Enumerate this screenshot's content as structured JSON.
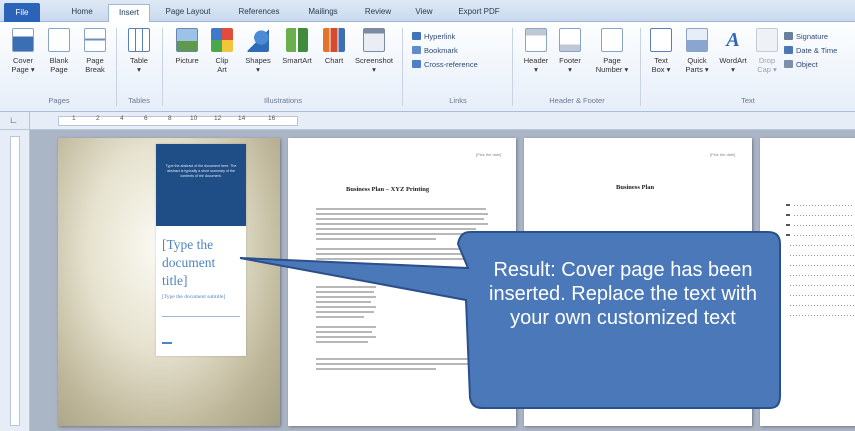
{
  "ribbon_tabs": [
    "File",
    "Home",
    "Insert",
    "Page Layout",
    "References",
    "Mailings",
    "Review",
    "View",
    "Export PDF"
  ],
  "active_tab": "Insert",
  "groups": {
    "pages": {
      "label": "Pages",
      "buttons": [
        {
          "label": "Cover\nPage ▾",
          "icon": "cover-page-icon"
        },
        {
          "label": "Blank\nPage",
          "icon": "blank-page-icon"
        },
        {
          "label": "Page\nBreak",
          "icon": "page-break-icon"
        }
      ]
    },
    "tables": {
      "label": "Tables",
      "buttons": [
        {
          "label": "Table\n▾",
          "icon": "table-icon"
        }
      ]
    },
    "illustrations": {
      "label": "Illustrations",
      "buttons": [
        {
          "label": "Picture",
          "icon": "picture-icon"
        },
        {
          "label": "Clip\nArt",
          "icon": "clip-art-icon"
        },
        {
          "label": "Shapes\n▾",
          "icon": "shapes-icon"
        },
        {
          "label": "SmartArt",
          "icon": "smartart-icon"
        },
        {
          "label": "Chart",
          "icon": "chart-icon"
        },
        {
          "label": "Screenshot\n▾",
          "icon": "screenshot-icon"
        }
      ]
    },
    "links": {
      "label": "Links",
      "items": [
        {
          "label": "Hyperlink",
          "icon": "hyperlink-icon"
        },
        {
          "label": "Bookmark",
          "icon": "bookmark-icon"
        },
        {
          "label": "Cross-reference",
          "icon": "cross-reference-icon"
        }
      ]
    },
    "header_footer": {
      "label": "Header & Footer",
      "buttons": [
        {
          "label": "Header\n▾",
          "icon": "header-icon"
        },
        {
          "label": "Footer\n▾",
          "icon": "footer-icon"
        },
        {
          "label": "Page\nNumber ▾",
          "icon": "page-number-icon"
        }
      ]
    },
    "text": {
      "label": "Text",
      "buttons": [
        {
          "label": "Text\nBox ▾",
          "icon": "text-box-icon"
        },
        {
          "label": "Quick\nParts ▾",
          "icon": "quick-parts-icon"
        },
        {
          "label": "WordArt\n▾",
          "icon": "wordart-icon"
        },
        {
          "label": "Drop\nCap ▾",
          "icon": "drop-cap-icon"
        }
      ],
      "items": [
        {
          "label": "Signature",
          "icon": "signature-icon"
        },
        {
          "label": "Date & Time",
          "icon": "date-time-icon"
        },
        {
          "label": "Object",
          "icon": "object-icon"
        }
      ]
    }
  },
  "ruler_numbers": [
    "1",
    "2",
    "4",
    "6",
    "8",
    "10",
    "12",
    "14",
    "16"
  ],
  "cover_page": {
    "abstract": "Type the abstract of the document here. The abstract is typically a short summary of the contents of the document.",
    "title": "[Type the document title]",
    "subtitle": "[Type the document subtitle]"
  },
  "page2": {
    "date": "[Pick the date]",
    "heading": "Business Plan – XYZ Printing"
  },
  "page3": {
    "date": "[Pick the date]",
    "heading": "Business Plan"
  },
  "callout": {
    "text": "Result: Cover page has been inserted. Replace the text with your own customized text"
  },
  "colors": {
    "callout_fill": "#4a78b8",
    "callout_border": "#2b4f8a",
    "cover_blue": "#1f4e87",
    "title_blue": "#4d84c4",
    "file_tab": "#2b63b8"
  }
}
